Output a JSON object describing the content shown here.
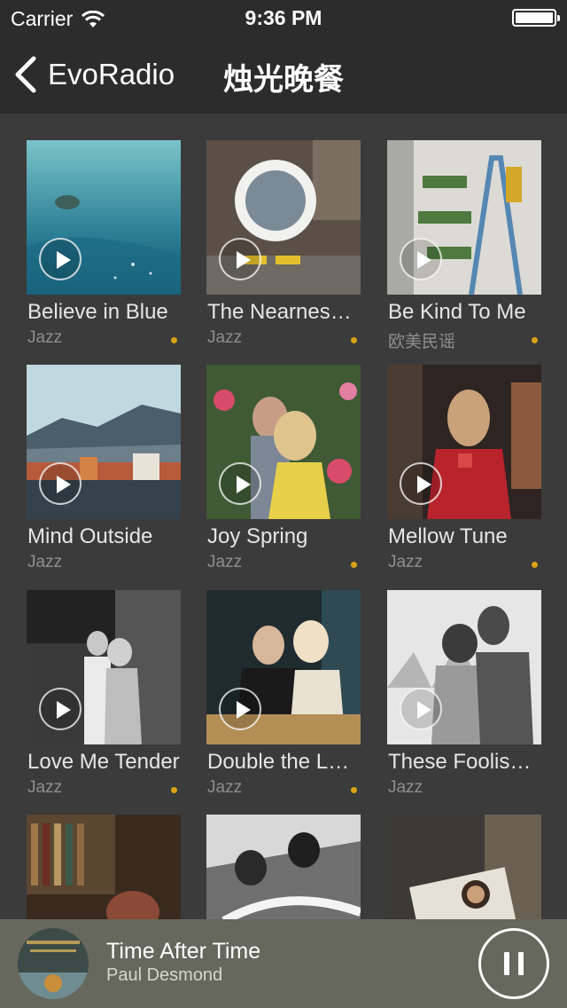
{
  "status_bar": {
    "carrier": "Carrier",
    "time": "9:36 PM"
  },
  "nav": {
    "back_label": "EvoRadio",
    "title": "烛光晚餐"
  },
  "colors": {
    "accent_dot": "#d8a213",
    "background": "#3b3b3b",
    "bar": "#2c2c2c",
    "player": "#66675d"
  },
  "albums": [
    {
      "title": "Believe in Blue",
      "genre": "Jazz",
      "dot": true
    },
    {
      "title": "The Nearness of You",
      "genre": "Jazz",
      "dot": true
    },
    {
      "title": "Be Kind To Me",
      "genre": "欧美民谣",
      "dot": true
    },
    {
      "title": "Mind Outside",
      "genre": "Jazz",
      "dot": false
    },
    {
      "title": "Joy Spring",
      "genre": "Jazz",
      "dot": true
    },
    {
      "title": "Mellow Tune",
      "genre": "Jazz",
      "dot": true
    },
    {
      "title": "Love Me Tender",
      "genre": "Jazz",
      "dot": true
    },
    {
      "title": "Double the Love",
      "genre": "Jazz",
      "dot": true
    },
    {
      "title": "These Foolish Things",
      "genre": "Jazz",
      "dot": false
    },
    {
      "title": "",
      "genre": "",
      "dot": false
    },
    {
      "title": "",
      "genre": "",
      "dot": false
    },
    {
      "title": "",
      "genre": "",
      "dot": false
    }
  ],
  "now_playing": {
    "title": "Time After Time",
    "artist": "Paul Desmond"
  },
  "icons": {
    "back": "chevron-left-icon",
    "play": "play-icon",
    "pause": "pause-icon",
    "wifi": "wifi-icon",
    "battery": "battery-icon"
  }
}
